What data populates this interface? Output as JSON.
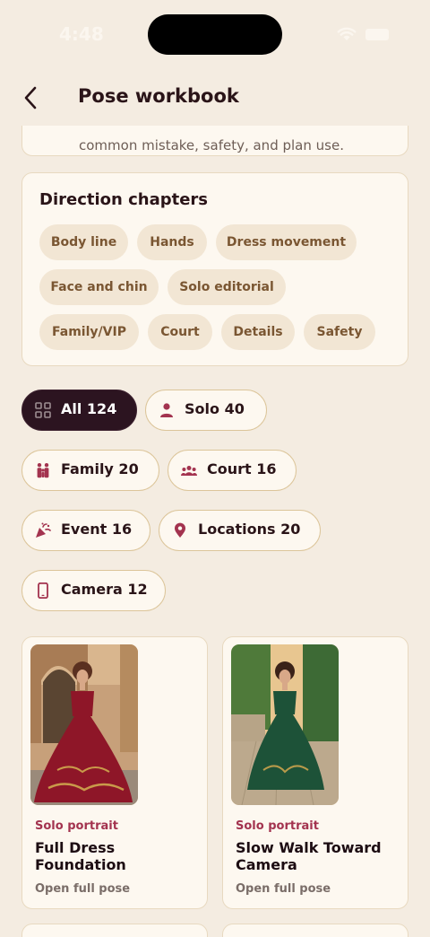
{
  "status": {
    "time": "4:48"
  },
  "header": {
    "title": "Pose workbook"
  },
  "intro": {
    "text": "common mistake, safety, and plan use."
  },
  "chapters": {
    "title": "Direction chapters",
    "items": [
      "Body line",
      "Hands",
      "Dress movement",
      "Face and chin",
      "Solo editorial",
      "Family/VIP",
      "Court",
      "Details",
      "Safety"
    ]
  },
  "filters": [
    {
      "label": "All  124",
      "icon": "grid-icon",
      "active": true
    },
    {
      "label": "Solo  40",
      "icon": "person-icon"
    },
    {
      "label": "Family  20",
      "icon": "family-icon"
    },
    {
      "label": "Court  16",
      "icon": "group-icon"
    },
    {
      "label": "Event  16",
      "icon": "party-popper-icon"
    },
    {
      "label": "Locations  20",
      "icon": "location-pin-icon"
    },
    {
      "label": "Camera  12",
      "icon": "phone-camera-icon"
    }
  ],
  "poses": [
    {
      "category": "Solo portrait",
      "title": "Full Dress Foundation",
      "link": "Open full pose",
      "dress_color": "#8e1628"
    },
    {
      "category": "Solo portrait",
      "title": "Slow Walk Toward Camera",
      "link": "Open full pose",
      "dress_color": "#1d5238"
    }
  ],
  "colors": {
    "accent": "#a3334f",
    "active_pill": "#2c1420",
    "background": "#f4ece1"
  }
}
